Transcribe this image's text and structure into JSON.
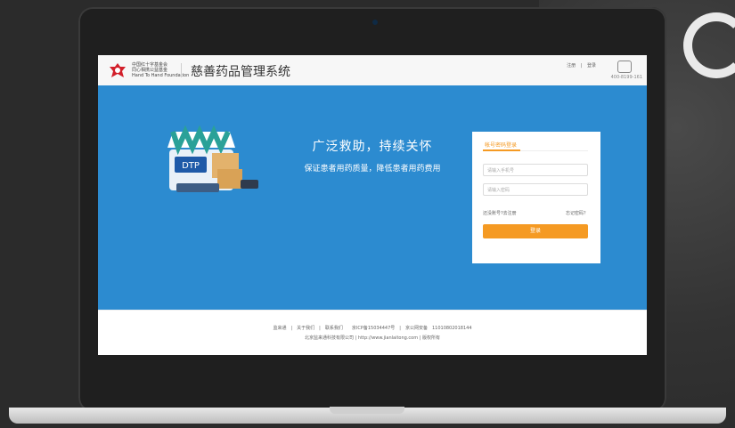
{
  "header": {
    "logo_org_lines": [
      "中国红十字基金会",
      "同心相携公益基金",
      "Hand To Hand Foundation"
    ],
    "system_title": "慈善药品管理系统",
    "links": [
      "注册",
      "|",
      "登录"
    ],
    "phone": "400-8199-161"
  },
  "hero": {
    "headline": "广泛救助，持续关怀",
    "subline": "保证患者用药质量，降低患者用药费用",
    "shop_sign": "DTP"
  },
  "login": {
    "tab_label": "帐号密码登录",
    "username_placeholder": "请输入手机号",
    "password_placeholder": "请输入密码",
    "register_link": "还没账号?去注册",
    "forgot_link": "忘记密码？",
    "submit_label": "登录"
  },
  "footer": {
    "line1": "监来通　|　关于我们　|　联系我们　　京ICP备15034447号　|　京公网安备　11010802018144",
    "line2": "北京监来通科技有限公司 | http://www.jianlaitong.com | 版权所有"
  },
  "colors": {
    "hero_bg": "#2c8bd0",
    "accent": "#f59a23"
  }
}
